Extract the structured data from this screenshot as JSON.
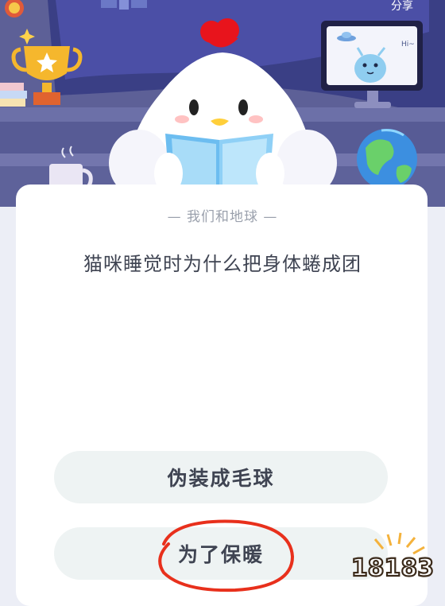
{
  "header": {
    "share_label": "分享"
  },
  "quiz": {
    "category": "— 我们和地球 —",
    "question": "猫咪睡觉时为什么把身体蜷成团",
    "options": [
      {
        "label": "伪装成毛球"
      },
      {
        "label": "为了保暖"
      }
    ]
  },
  "monitor": {
    "greeting": "Hi~"
  },
  "watermark": {
    "text": "18183"
  },
  "colors": {
    "scene_bg": "#5d6097",
    "card_bg": "#ffffff",
    "option_bg": "#eef3f3",
    "annotation_red": "#e8301c",
    "comb_red": "#e8141c"
  },
  "icons": [
    "badge-icon",
    "trophy-icon",
    "sparkle-icon",
    "books-icon",
    "satellite-icon",
    "mug-icon",
    "chicken-mascot",
    "tv-monitor-icon",
    "alien-icon",
    "ufo-icon",
    "globe-icon",
    "watermark-logo"
  ]
}
